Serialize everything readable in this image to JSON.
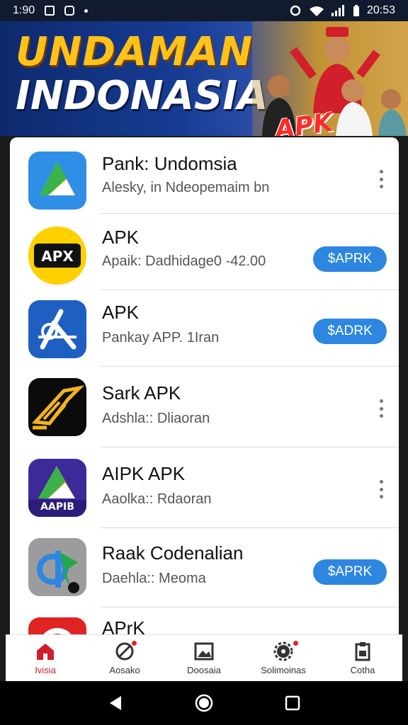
{
  "status": {
    "time_left": "1:90",
    "time_right": "20:53"
  },
  "banner": {
    "line1": "UNDAMAN",
    "line2": "INDONASIA",
    "apk_badge": "APK"
  },
  "apps": [
    {
      "name": "Pank: Undomsia",
      "sub": "Alesky, in Ndeopemaim bn",
      "action": "menu",
      "icon": "drive-triangle-icon"
    },
    {
      "name": "APK",
      "sub": "Apaik: Dadhidage0 -42.00",
      "action_label": "$APRK",
      "action": "button",
      "icon": "apx-badge-icon"
    },
    {
      "name": "APK",
      "sub": "Pankay APP. 1Iran",
      "action_label": "$ADRK",
      "action": "button",
      "icon": "app-store-a-icon"
    },
    {
      "name": "Sark APK",
      "sub": "Adshla:: Dliaoran",
      "action": "menu",
      "icon": "gold-arrow-icon"
    },
    {
      "name": "AIPK APK",
      "sub": "Aaolka:: Rdaoran",
      "action": "menu",
      "icon": "aapib-triangle-icon",
      "icon_text": "AAPIB"
    },
    {
      "name": "Raak Codenalian",
      "sub": "Daehla:: Meoma",
      "action_label": "$APRK",
      "action": "button",
      "icon": "d-flag-icon"
    },
    {
      "name": "APrK",
      "sub": "",
      "action": "none",
      "icon": "red-circle-icon"
    }
  ],
  "tabs": [
    {
      "label": "Ivisia",
      "icon": "home-icon",
      "active": true,
      "badge": false
    },
    {
      "label": "Aosako",
      "icon": "blocked-circle-icon",
      "active": false,
      "badge": true
    },
    {
      "label": "Doosaia",
      "icon": "image-frame-icon",
      "active": false,
      "badge": false
    },
    {
      "label": "Solimoinas",
      "icon": "gear-badge-icon",
      "active": false,
      "badge": true
    },
    {
      "label": "Cotha",
      "icon": "clipboard-icon",
      "active": false,
      "badge": false
    }
  ],
  "colors": {
    "accent": "#2d86e0",
    "active_tab": "#d11f2b",
    "banner_blue": "#173c94",
    "banner_gold": "#ffc21a"
  }
}
